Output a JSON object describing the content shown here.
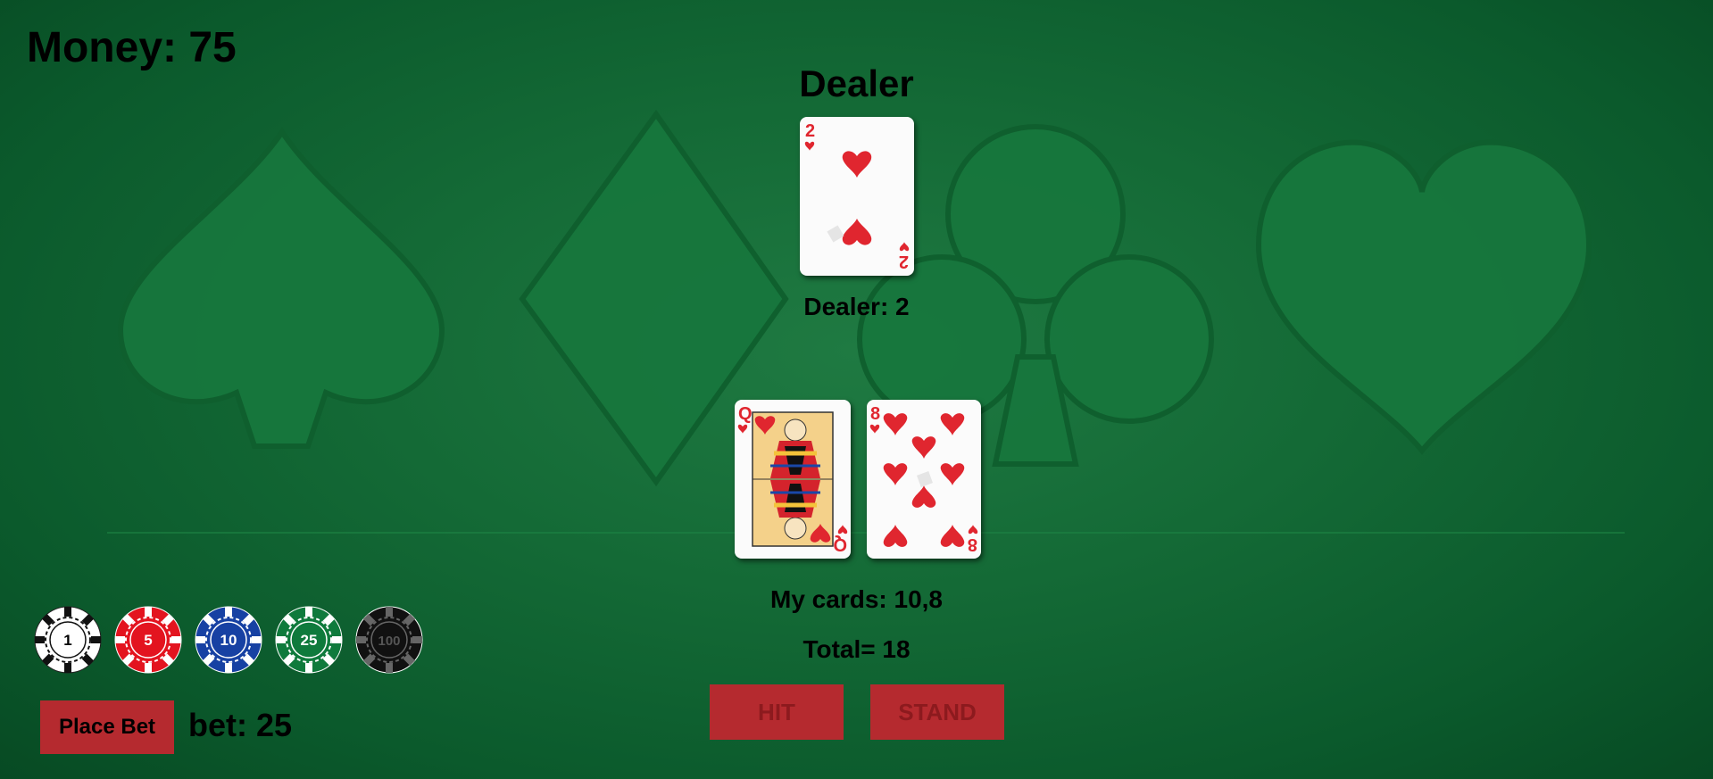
{
  "money_label": "Money: 75",
  "dealer": {
    "title": "Dealer",
    "score_label": "Dealer: 2",
    "cards": [
      {
        "rank": "2",
        "suit": "hearts"
      }
    ]
  },
  "player": {
    "cards": [
      {
        "rank": "Q",
        "suit": "hearts"
      },
      {
        "rank": "8",
        "suit": "hearts"
      }
    ],
    "cards_label": "My cards: 10,8",
    "total_label": "Total= 18"
  },
  "buttons": {
    "hit": "HIT",
    "stand": "STAND",
    "place_bet": "Place Bet"
  },
  "bet_label": "bet: 25",
  "chips": [
    {
      "value": "1",
      "color": "#ffffff",
      "text_color": "#000000"
    },
    {
      "value": "5",
      "color": "#e3141f",
      "text_color": "#ffffff"
    },
    {
      "value": "10",
      "color": "#1741a3",
      "text_color": "#ffffff"
    },
    {
      "value": "25",
      "color": "#0f7a3c",
      "text_color": "#ffffff"
    },
    {
      "value": "100",
      "color": "#111111",
      "text_color": "#555555"
    }
  ],
  "colors": {
    "felt": "#146a36",
    "button": "#b52a2f",
    "card_red": "#e0262f"
  },
  "felt_suits": [
    "spade-icon",
    "diamond-icon",
    "club-icon",
    "heart-icon"
  ]
}
